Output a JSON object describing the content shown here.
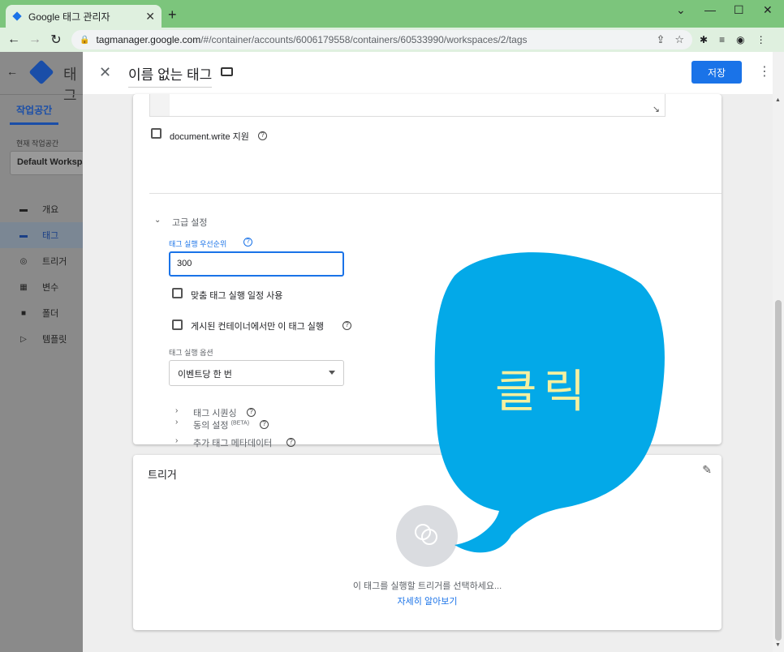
{
  "browser": {
    "tab_title": "Google 태그 관리자",
    "tab_close": "✕",
    "new_tab": "+",
    "window_controls": [
      "⌄",
      "—",
      "☐",
      "✕"
    ],
    "url_host": "tagmanager.google.com",
    "url_path": "/#/container/accounts/6006179558/containers/60533990/workspaces/2/tags"
  },
  "sidebar": {
    "title": "태그",
    "workspace_tab": "작업공간",
    "current_workspace_label": "현재 작업공간",
    "workspace_name": "Default Workspace",
    "items": [
      {
        "label": "개요",
        "icon": "overview-icon",
        "active": false
      },
      {
        "label": "태그",
        "icon": "tag-icon",
        "active": true
      },
      {
        "label": "트리거",
        "icon": "trigger-icon",
        "active": false
      },
      {
        "label": "변수",
        "icon": "variable-icon",
        "active": false
      },
      {
        "label": "폴더",
        "icon": "folder-icon",
        "active": false
      },
      {
        "label": "템플릿",
        "icon": "template-icon",
        "active": false
      }
    ]
  },
  "editor": {
    "tag_name": "이름 없는 태그",
    "save_label": "저장",
    "document_write_label": "document.write 지원",
    "advanced_settings_label": "고급 설정",
    "priority_label": "태그 실행 우선순위",
    "priority_value": "300",
    "custom_schedule_label": "맞춤 태그 실행 일정 사용",
    "published_only_label": "게시된 컨테이너에서만 이 태그 실행",
    "firing_options_label": "태그 실행 옵션",
    "firing_options_value": "이벤트당 한 번",
    "tag_sequencing_label": "태그 시퀀싱",
    "metadata_label": "추가 태그 메타데이터",
    "consent_label": "동의 설정",
    "consent_badge": "(BETA)"
  },
  "trigger": {
    "title": "트리거",
    "help_text": "이 태그를 실행할 트리거를 선택하세요...",
    "learn_more": "자세히 알아보기"
  },
  "callout": {
    "text": "클릭",
    "color": "#03a9e8",
    "text_color": "#f5f0a0"
  },
  "colors": {
    "accent": "#1a73e8",
    "browser_frame": "#7cc57c"
  }
}
